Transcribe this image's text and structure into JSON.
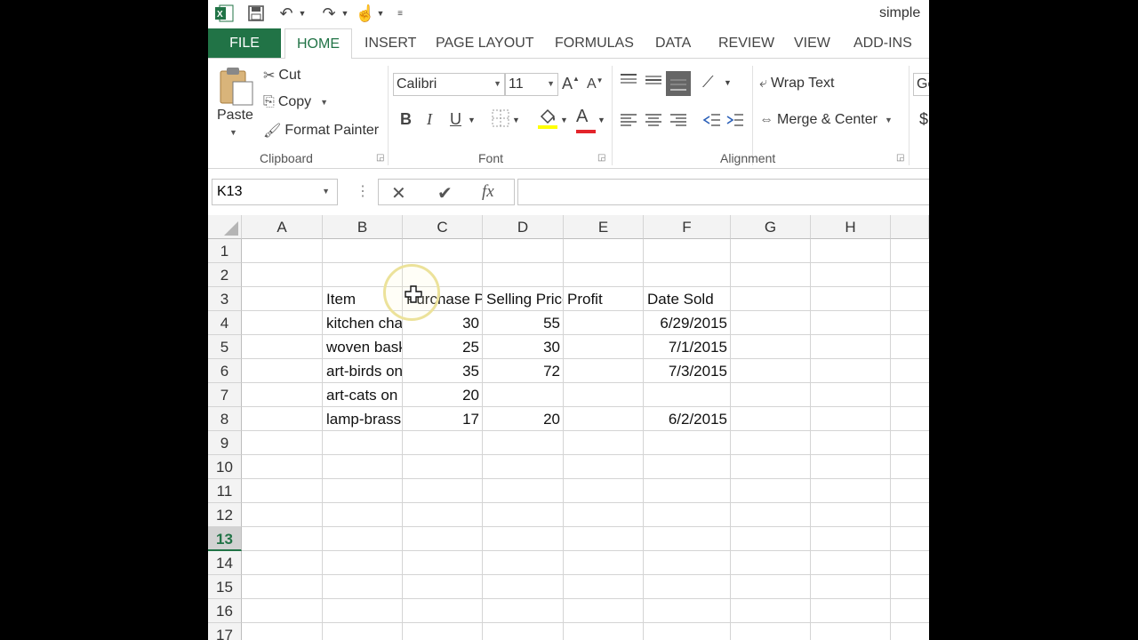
{
  "app": {
    "title": "simple"
  },
  "tabs": [
    "FILE",
    "HOME",
    "INSERT",
    "PAGE LAYOUT",
    "FORMULAS",
    "DATA",
    "REVIEW",
    "VIEW",
    "ADD-INS"
  ],
  "ribbon": {
    "clipboard": {
      "label": "Clipboard",
      "paste": "Paste",
      "cut": "Cut",
      "copy": "Copy",
      "format_painter": "Format Painter"
    },
    "font": {
      "label": "Font",
      "name": "Calibri",
      "size": "11",
      "bold": "B",
      "italic": "I",
      "underline": "U",
      "grow": "A",
      "shrink": "A",
      "font_color": "A"
    },
    "alignment": {
      "label": "Alignment",
      "wrap_text": "Wrap Text",
      "merge_center": "Merge & Center"
    },
    "number": {
      "format_partial": "Ge",
      "currency_partial": "$"
    }
  },
  "formula_bar": {
    "name_box": "K13",
    "fx": "fx",
    "cancel": "✕",
    "enter": "✔",
    "formula": ""
  },
  "grid": {
    "columns": [
      "A",
      "B",
      "C",
      "D",
      "E",
      "F",
      "G",
      "H"
    ],
    "rows": [
      "1",
      "2",
      "3",
      "4",
      "5",
      "6",
      "7",
      "8",
      "9",
      "10",
      "11",
      "12",
      "13",
      "14",
      "15",
      "16",
      "17"
    ],
    "selected_row": "13",
    "cells": {
      "B3": "Item",
      "C3": "Purchase Price",
      "D3": "Selling Price",
      "E3": "Profit",
      "F3": "Date Sold",
      "B4": "kitchen chair",
      "C4": "30",
      "D4": "55",
      "F4": "6/29/2015",
      "B5": "woven basket",
      "C5": "25",
      "D5": "30",
      "F5": "7/1/2015",
      "B6": "art-birds on branch",
      "C6": "35",
      "D6": "72",
      "F6": "7/3/2015",
      "B7": "art-cats on pillow",
      "C7": "20",
      "B8": "lamp-brass",
      "C8": "17",
      "D8": "20",
      "F8": "6/2/2015"
    }
  },
  "colors": {
    "accent": "#217346",
    "font_color_bar": "#e3242b",
    "highlight_bar": "#ffff00"
  }
}
